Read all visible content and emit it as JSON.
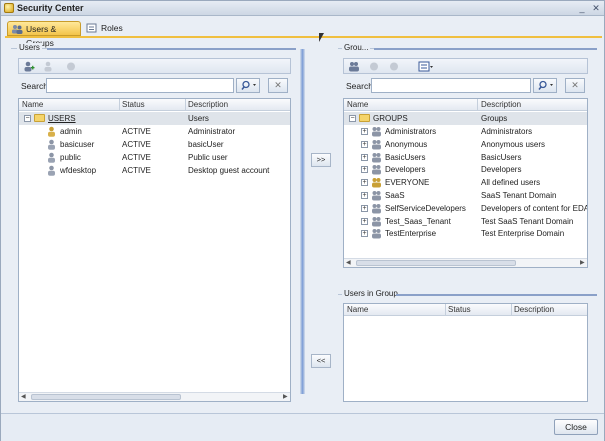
{
  "window": {
    "title": "Security Center",
    "minimize_label": "_",
    "close_label": "✕"
  },
  "tabs": [
    {
      "label": "Users & Groups",
      "active": true
    },
    {
      "label": "Roles",
      "active": false
    }
  ],
  "users_panel": {
    "legend": "Users",
    "search_label": "Search:",
    "search_value": "",
    "clear_label": "✕",
    "columns": [
      "Name",
      "Status",
      "Description"
    ],
    "root": {
      "name": "USERS",
      "description": "Users"
    },
    "rows": [
      {
        "name": "admin",
        "status": "ACTIVE",
        "description": "Administrator"
      },
      {
        "name": "basicuser",
        "status": "ACTIVE",
        "description": "basicUser"
      },
      {
        "name": "public",
        "status": "ACTIVE",
        "description": "Public user"
      },
      {
        "name": "wfdesktop",
        "status": "ACTIVE",
        "description": "Desktop guest account"
      }
    ]
  },
  "groups_panel": {
    "legend": "Grou...",
    "search_label": "Search:",
    "search_value": "",
    "clear_label": "✕",
    "columns": [
      "Name",
      "Description"
    ],
    "root": {
      "name": "GROUPS",
      "description": "Groups"
    },
    "rows": [
      {
        "name": "Administrators",
        "description": "Administrators"
      },
      {
        "name": "Anonymous",
        "description": "Anonymous users"
      },
      {
        "name": "BasicUsers",
        "description": "BasicUsers"
      },
      {
        "name": "Developers",
        "description": "Developers"
      },
      {
        "name": "EVERYONE",
        "description": "All defined users"
      },
      {
        "name": "SaaS",
        "description": "SaaS Tenant Domain"
      },
      {
        "name": "SelfServiceDevelopers",
        "description": "Developers of content for EDA an"
      },
      {
        "name": "Test_Saas_Tenant",
        "description": "Test SaaS Tenant Domain"
      },
      {
        "name": "TestEnterprise",
        "description": "Test Enterprise Domain"
      }
    ]
  },
  "users_in_group_panel": {
    "legend": "Users in Group",
    "columns": [
      "Name",
      "Status",
      "Description"
    ]
  },
  "buttons": {
    "add_to_group": ">>",
    "remove_from_group": "<<",
    "close": "Close"
  },
  "colors": {
    "tab_active": "#f3c44b",
    "accent": "#4a78c8"
  }
}
